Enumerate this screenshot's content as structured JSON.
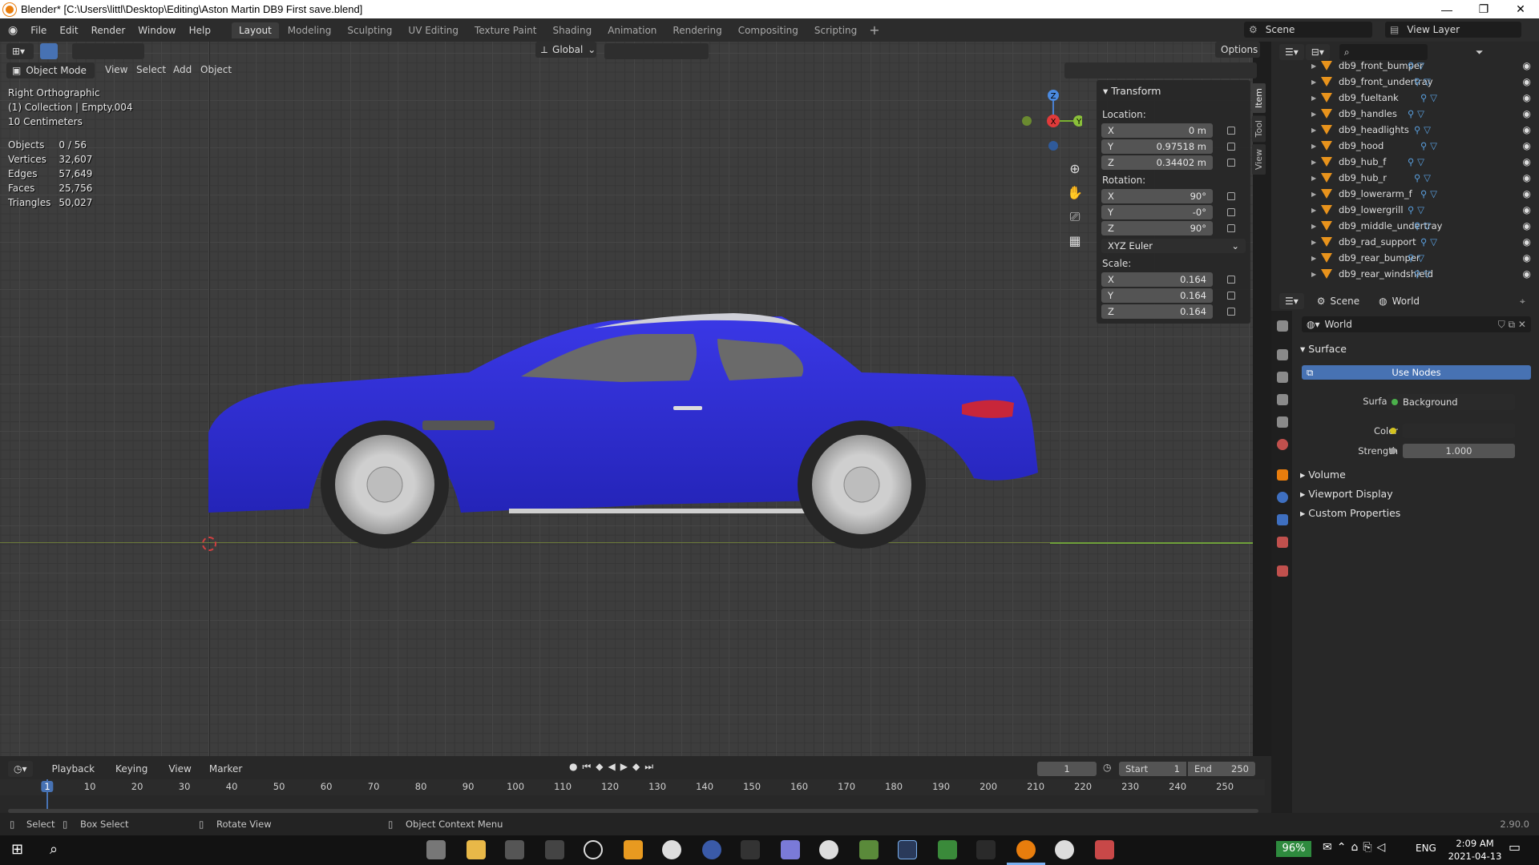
{
  "window": {
    "title": "Blender* [C:\\Users\\littl\\Desktop\\Editing\\Aston Martin DB9 First save.blend]",
    "controls": [
      "—",
      "❐",
      "✕"
    ]
  },
  "menu": [
    "File",
    "Edit",
    "Render",
    "Window",
    "Help"
  ],
  "workspaces": [
    "Layout",
    "Modeling",
    "Sculpting",
    "UV Editing",
    "Texture Paint",
    "Shading",
    "Animation",
    "Rendering",
    "Compositing",
    "Scripting"
  ],
  "active_workspace": "Layout",
  "scene_field": "Scene",
  "view_layer_field": "View Layer",
  "viewport_header": {
    "orientation": "Global",
    "options": "Options",
    "mode": "Object Mode",
    "menus": [
      "View",
      "Select",
      "Add",
      "Object"
    ]
  },
  "viewport_info": {
    "view": "Right Orthographic",
    "collection": "(1) Collection | Empty.004",
    "scale": "10 Centimeters"
  },
  "stats": [
    {
      "label": "Objects",
      "value": "0 / 56"
    },
    {
      "label": "Vertices",
      "value": "32,607"
    },
    {
      "label": "Edges",
      "value": "57,649"
    },
    {
      "label": "Faces",
      "value": "25,756"
    },
    {
      "label": "Triangles",
      "value": "50,027"
    }
  ],
  "transform_panel": {
    "title": "Transform",
    "location_label": "Location:",
    "location": [
      {
        "axis": "X",
        "value": "0 m"
      },
      {
        "axis": "Y",
        "value": "0.97518 m"
      },
      {
        "axis": "Z",
        "value": "0.34402 m"
      }
    ],
    "rotation_label": "Rotation:",
    "rotation": [
      {
        "axis": "X",
        "value": "90°"
      },
      {
        "axis": "Y",
        "value": "-0°"
      },
      {
        "axis": "Z",
        "value": "90°"
      }
    ],
    "rotation_mode": "XYZ Euler",
    "scale_label": "Scale:",
    "scale": [
      {
        "axis": "X",
        "value": "0.164"
      },
      {
        "axis": "Y",
        "value": "0.164"
      },
      {
        "axis": "Z",
        "value": "0.164"
      }
    ]
  },
  "side_tabs": [
    "Item",
    "Tool",
    "View"
  ],
  "gizmo": {
    "x": "X",
    "y": "Y",
    "z": "Z"
  },
  "outliner": [
    "db9_front_bumper",
    "db9_front_undertray",
    "db9_fueltank",
    "db9_handles",
    "db9_headlights",
    "db9_hood",
    "db9_hub_f",
    "db9_hub_r",
    "db9_lowerarm_f",
    "db9_lowergrill",
    "db9_middle_undertray",
    "db9_rad_support",
    "db9_rear_bumper",
    "db9_rear_windshield"
  ],
  "properties": {
    "breadcrumb_scene": "Scene",
    "breadcrumb_world": "World",
    "world_name": "World",
    "surface_section": "Surface",
    "use_nodes": "Use Nodes",
    "surface_label": "Surface",
    "surface_value": "Background",
    "color_label": "Color",
    "strength_label": "Strength",
    "strength_value": "1.000",
    "collapsed_sections": [
      "Volume",
      "Viewport Display",
      "Custom Properties"
    ]
  },
  "timeline": {
    "menus": [
      "Playback",
      "Keying",
      "View",
      "Marker"
    ],
    "current_frame": "1",
    "start_label": "Start",
    "start": "1",
    "end_label": "End",
    "end": "250",
    "ticks": [
      "1",
      "10",
      "20",
      "30",
      "40",
      "50",
      "60",
      "70",
      "80",
      "90",
      "100",
      "110",
      "120",
      "130",
      "140",
      "150",
      "160",
      "170",
      "180",
      "190",
      "200",
      "210",
      "220",
      "230",
      "240",
      "250"
    ]
  },
  "statusbar": {
    "select": "Select",
    "box_select": "Box Select",
    "rotate_view": "Rotate View",
    "context_menu": "Object Context Menu",
    "version": "2.90.0"
  },
  "taskbar": {
    "battery": "96%",
    "language": "ENG",
    "time": "2:09 AM",
    "date": "2021-04-13"
  },
  "colors": {
    "car_body": "#2b2ad4",
    "accent_blue": "#4772b3",
    "outliner_object": "#e8931c"
  }
}
